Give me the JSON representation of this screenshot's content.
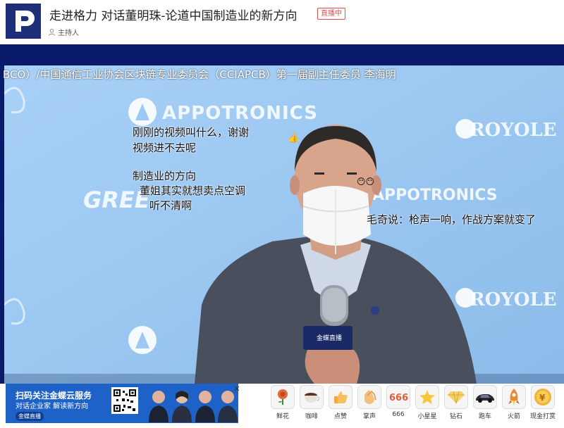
{
  "header": {
    "title": "走进格力 对话董明珠-论道中国制造业的新方向",
    "live_badge": "直播中",
    "host_label": "主持人"
  },
  "video": {
    "caption": "BCO）/中国通信工业协会区块链专业委员会（CCIAPCB）第一届副主任委员 李海明",
    "backdrop_brands": [
      "APPOTRONICS",
      "ROYOLE",
      "APPOTRONICS",
      "ROYOLE",
      "GREE"
    ],
    "mic_label": "金蝶直播",
    "danmu": [
      "刚刚的视频叫什么，谢谢",
      "视频进不去呢",
      "制造业的方向",
      "董姐其实就想卖点空调",
      "听不清啊",
      "毛奇说：枪声一响，作战方案就变了"
    ]
  },
  "ad": {
    "line1": "扫码关注金蝶云服务",
    "line2": "对话企业家 解读新方向",
    "brand": "金蝶直播",
    "close": "✕"
  },
  "gifts": [
    {
      "label": "鲜花",
      "icon": "flower-icon"
    },
    {
      "label": "咖啡",
      "icon": "coffee-icon"
    },
    {
      "label": "点赞",
      "icon": "thumbs-up-icon"
    },
    {
      "label": "掌声",
      "icon": "clap-icon"
    },
    {
      "label": "666",
      "icon": "666-icon"
    },
    {
      "label": "小星星",
      "icon": "star-icon"
    },
    {
      "label": "钻石",
      "icon": "diamond-icon"
    },
    {
      "label": "跑车",
      "icon": "car-icon"
    },
    {
      "label": "火箭",
      "icon": "rocket-icon"
    },
    {
      "label": "现金打赏",
      "icon": "coin-icon"
    }
  ],
  "colors": {
    "accent": "#1d2e7a",
    "live": "#e54b4b",
    "video_bg": "#9cc8f3",
    "ad_bg": "#1f62c7"
  }
}
